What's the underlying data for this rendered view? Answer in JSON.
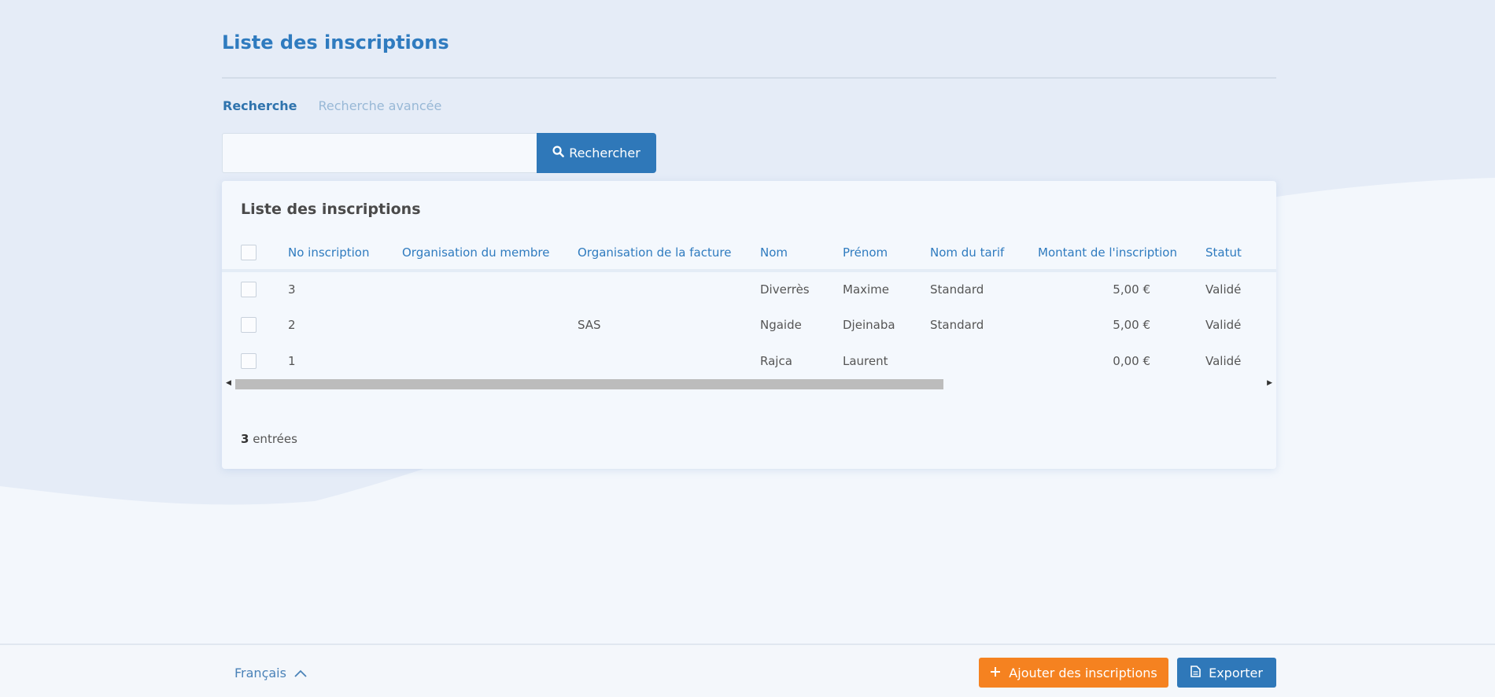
{
  "page": {
    "title": "Liste des inscriptions"
  },
  "tabs": [
    {
      "label": "Recherche",
      "active": true
    },
    {
      "label": "Recherche avancée",
      "active": false
    }
  ],
  "search": {
    "value": "",
    "placeholder": "",
    "button_label": "Rechercher",
    "button_icon": "search-icon"
  },
  "card": {
    "title": "Liste des inscriptions",
    "columns": [
      "No inscription",
      "Organisation du membre",
      "Organisation de la facture",
      "Nom",
      "Prénom",
      "Nom du tarif",
      "Montant de l'inscription",
      "Statut"
    ],
    "rows": [
      {
        "no": "3",
        "org_membre": "",
        "org_facture": "",
        "nom": "Diverrès",
        "prenom": "Maxime",
        "tarif": "Standard",
        "montant": "5,00 €",
        "statut": "Validé"
      },
      {
        "no": "2",
        "org_membre": "",
        "org_facture": "SAS",
        "nom": "Ngaide",
        "prenom": "Djeinaba",
        "tarif": "Standard",
        "montant": "5,00 €",
        "statut": "Validé"
      },
      {
        "no": "1",
        "org_membre": "",
        "org_facture": "",
        "nom": "Rajca",
        "prenom": "Laurent",
        "tarif": "",
        "montant": "0,00 €",
        "statut": "Validé"
      }
    ],
    "scroll": {
      "visible_fraction": 0.69,
      "position_fraction": 0.0
    },
    "entries_count": "3",
    "entries_label": " entrées"
  },
  "footer": {
    "language": "Français",
    "add_label": "Ajouter des inscriptions",
    "export_label": "Exporter"
  },
  "colors": {
    "accent": "#2f78b9",
    "orange": "#f58220",
    "background": "#f3f7fc",
    "wave": "#e5ecf7"
  }
}
